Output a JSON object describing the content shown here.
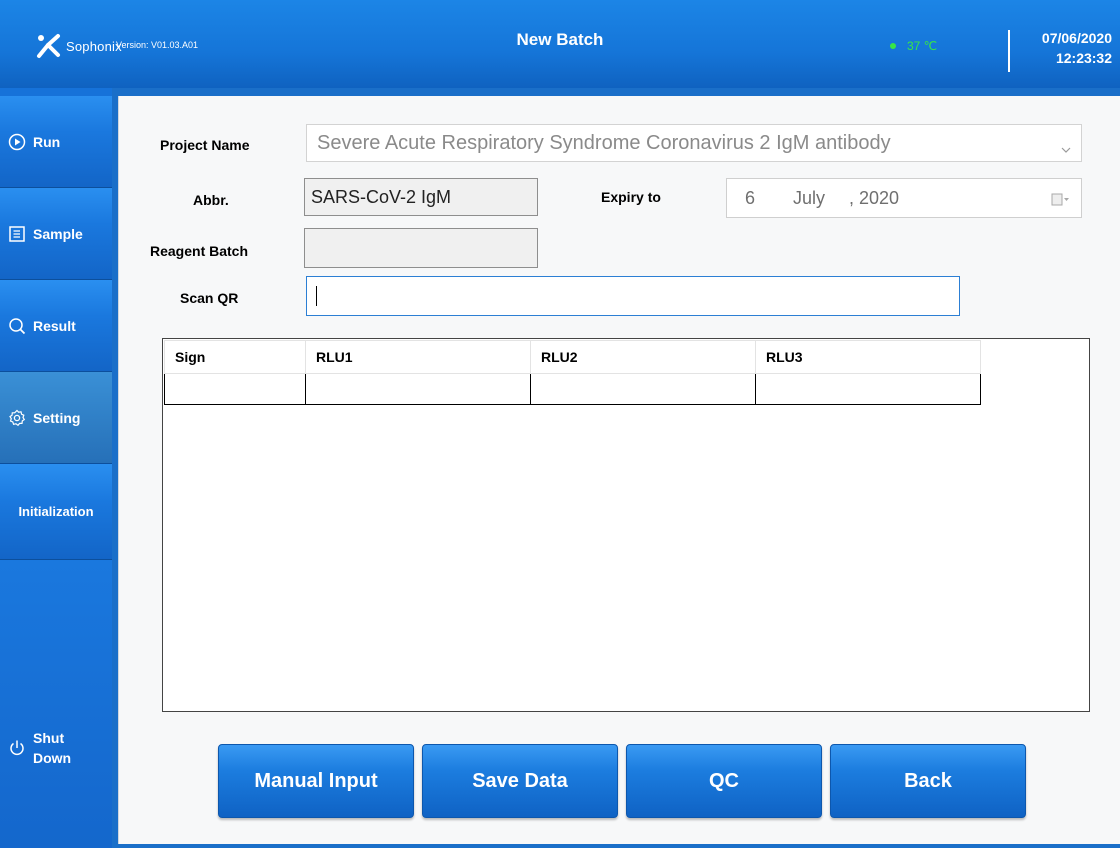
{
  "header": {
    "brand": "Sophonix",
    "version": "Version: V01.03.A01",
    "title": "New Batch",
    "temperature": "37 ℃",
    "date": "07/06/2020",
    "time": "12:23:32"
  },
  "sidebar": {
    "items": [
      {
        "label": "Run",
        "icon": "play-icon"
      },
      {
        "label": "Sample",
        "icon": "document-icon"
      },
      {
        "label": "Result",
        "icon": "search-icon"
      },
      {
        "label": "Setting",
        "icon": "gear-icon"
      },
      {
        "label": "Initialization",
        "icon": ""
      },
      {
        "label": "Shut Down",
        "icon": "power-icon"
      }
    ],
    "active": "Setting"
  },
  "form": {
    "project_name_label": "Project Name",
    "project_name_value": "Severe Acute Respiratory Syndrome Coronavirus 2 IgM antibody",
    "abbr_label": "Abbr.",
    "abbr_value": "SARS-CoV-2 IgM",
    "expiry_label": "Expiry to",
    "expiry_day": "6",
    "expiry_month": "July",
    "expiry_year": ", 2020",
    "reagent_batch_label": "Reagent Batch",
    "reagent_batch_value": "",
    "scan_qr_label": "Scan QR",
    "scan_qr_value": ""
  },
  "table": {
    "columns": [
      "Sign",
      "RLU1",
      "RLU2",
      "RLU3"
    ],
    "rows": [
      [
        "",
        "",
        "",
        ""
      ]
    ]
  },
  "buttons": {
    "manual_input": "Manual Input",
    "save_data": "Save Data",
    "qc": "QC",
    "back": "Back"
  },
  "colors": {
    "header": "#1575d8",
    "sidebar": "#1672d9",
    "temperature": "#37e646"
  }
}
